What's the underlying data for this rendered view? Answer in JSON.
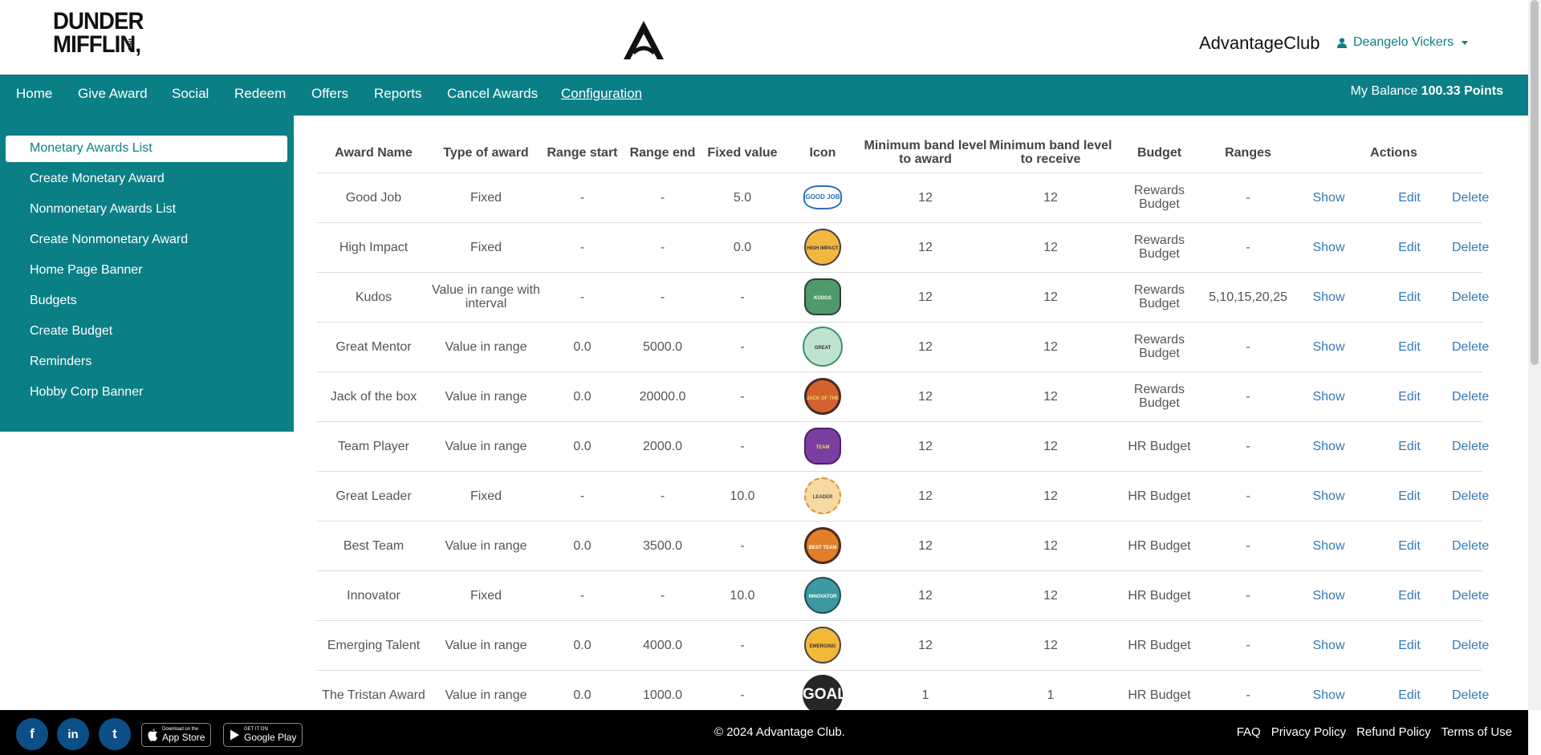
{
  "header": {
    "logo_line1": "DUNDER",
    "logo_line2": "MIFFLIN,",
    "logo_inc": "INC",
    "brand": "AdvantageClub",
    "user_name": "Deangelo Vickers"
  },
  "nav": {
    "items": [
      "Home",
      "Give Award",
      "Social",
      "Redeem",
      "Offers",
      "Reports",
      "Cancel Awards",
      "Configuration"
    ],
    "active": "Configuration",
    "balance_label": "My Balance",
    "balance_value": "100.33 Points"
  },
  "sidebar": {
    "items": [
      "Monetary Awards List",
      "Create Monetary Award",
      "Nonmonetary Awards List",
      "Create Nonmonetary Award",
      "Home Page Banner",
      "Budgets",
      "Create Budget",
      "Reminders",
      "Hobby Corp Banner"
    ],
    "active": "Monetary Awards List"
  },
  "table": {
    "headers": [
      "Award Name",
      "Type of award",
      "Range start",
      "Range end",
      "Fixed value",
      "Icon",
      "Minimum band level to award",
      "Minimum band level to receive",
      "Budget",
      "Ranges",
      "Actions"
    ],
    "action_labels": [
      "Show",
      "Edit",
      "Delete"
    ],
    "rows": [
      {
        "name": "Good Job",
        "type": "Fixed",
        "range_start": "-",
        "range_end": "-",
        "fixed": "5.0",
        "icon": "good-job-badge",
        "icon_text": "GOOD JOB",
        "min_award": "12",
        "min_receive": "12",
        "budget": "Rewards Budget",
        "ranges": "-"
      },
      {
        "name": "High Impact",
        "type": "Fixed",
        "range_start": "-",
        "range_end": "-",
        "fixed": "0.0",
        "icon": "high-impact-badge",
        "icon_text": "HIGH IMPACT",
        "min_award": "12",
        "min_receive": "12",
        "budget": "Rewards Budget",
        "ranges": "-"
      },
      {
        "name": "Kudos",
        "type": "Value in range with interval",
        "range_start": "-",
        "range_end": "-",
        "fixed": "-",
        "icon": "kudos-badge",
        "icon_text": "KUDOS",
        "min_award": "12",
        "min_receive": "12",
        "budget": "Rewards Budget",
        "ranges": "5,10,15,20,25"
      },
      {
        "name": "Great Mentor",
        "type": "Value in range",
        "range_start": "0.0",
        "range_end": "5000.0",
        "fixed": "-",
        "icon": "great-mentor-badge",
        "icon_text": "GREAT MENTOR",
        "min_award": "12",
        "min_receive": "12",
        "budget": "Rewards Budget",
        "ranges": "-"
      },
      {
        "name": "Jack of the box",
        "type": "Value in range",
        "range_start": "0.0",
        "range_end": "20000.0",
        "fixed": "-",
        "icon": "jack-of-the-box-badge",
        "icon_text": "JACK OF THE BOX",
        "min_award": "12",
        "min_receive": "12",
        "budget": "Rewards Budget",
        "ranges": "-"
      },
      {
        "name": "Team Player",
        "type": "Value in range",
        "range_start": "0.0",
        "range_end": "2000.0",
        "fixed": "-",
        "icon": "team-player-badge",
        "icon_text": "TEAM PLAYER",
        "min_award": "12",
        "min_receive": "12",
        "budget": "HR Budget",
        "ranges": "-"
      },
      {
        "name": "Great Leader",
        "type": "Fixed",
        "range_start": "-",
        "range_end": "-",
        "fixed": "10.0",
        "icon": "great-leader-badge",
        "icon_text": "LEADER",
        "min_award": "12",
        "min_receive": "12",
        "budget": "HR Budget",
        "ranges": "-"
      },
      {
        "name": "Best Team",
        "type": "Value in range",
        "range_start": "0.0",
        "range_end": "3500.0",
        "fixed": "-",
        "icon": "best-team-badge",
        "icon_text": "BEST TEAM",
        "min_award": "12",
        "min_receive": "12",
        "budget": "HR Budget",
        "ranges": "-"
      },
      {
        "name": "Innovator",
        "type": "Fixed",
        "range_start": "-",
        "range_end": "-",
        "fixed": "10.0",
        "icon": "innovator-badge",
        "icon_text": "INNOVATOR",
        "min_award": "12",
        "min_receive": "12",
        "budget": "HR Budget",
        "ranges": "-"
      },
      {
        "name": "Emerging Talent",
        "type": "Value in range",
        "range_start": "0.0",
        "range_end": "4000.0",
        "fixed": "-",
        "icon": "emerging-talent-badge",
        "icon_text": "EMERGING TALENT",
        "min_award": "12",
        "min_receive": "12",
        "budget": "HR Budget",
        "ranges": "-"
      },
      {
        "name": "The Tristan Award",
        "type": "Value in range",
        "range_start": "0.0",
        "range_end": "1000.0",
        "fixed": "-",
        "icon": "goal-badge",
        "icon_text": "GOAL",
        "min_award": "1",
        "min_receive": "1",
        "budget": "HR Budget",
        "ranges": "-"
      }
    ]
  },
  "footer": {
    "social": [
      "f",
      "in",
      "t"
    ],
    "appstore_small": "Download on the",
    "appstore_big": "App Store",
    "googleplay_small": "GET IT ON",
    "googleplay_big": "Google Play",
    "copyright": "© 2024 Advantage Club.",
    "links": [
      "FAQ",
      "Privacy Policy",
      "Refund Policy",
      "Terms of Use"
    ]
  },
  "colors": {
    "teal": "#0b7f86",
    "link": "#337ab7"
  }
}
